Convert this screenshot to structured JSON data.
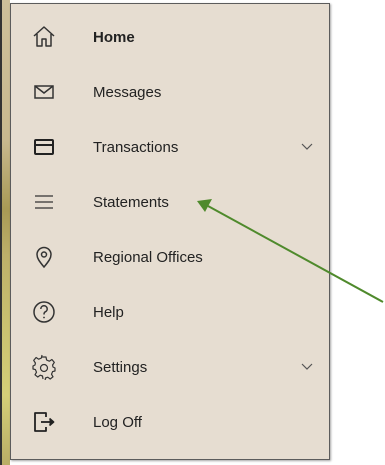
{
  "menu": {
    "items": [
      {
        "label": "Home",
        "icon": "home-icon"
      },
      {
        "label": "Messages",
        "icon": "envelope-icon"
      },
      {
        "label": "Transactions",
        "icon": "card-icon",
        "expandable": true
      },
      {
        "label": "Statements",
        "icon": "list-icon"
      },
      {
        "label": "Regional Offices",
        "icon": "location-pin-icon"
      },
      {
        "label": "Help",
        "icon": "help-icon"
      },
      {
        "label": "Settings",
        "icon": "gear-icon",
        "expandable": true
      },
      {
        "label": "Log Off",
        "icon": "logoff-icon"
      }
    ]
  },
  "colors": {
    "menu_background": "#e6ddd1",
    "annotation_arrow": "#4f8a2c"
  }
}
